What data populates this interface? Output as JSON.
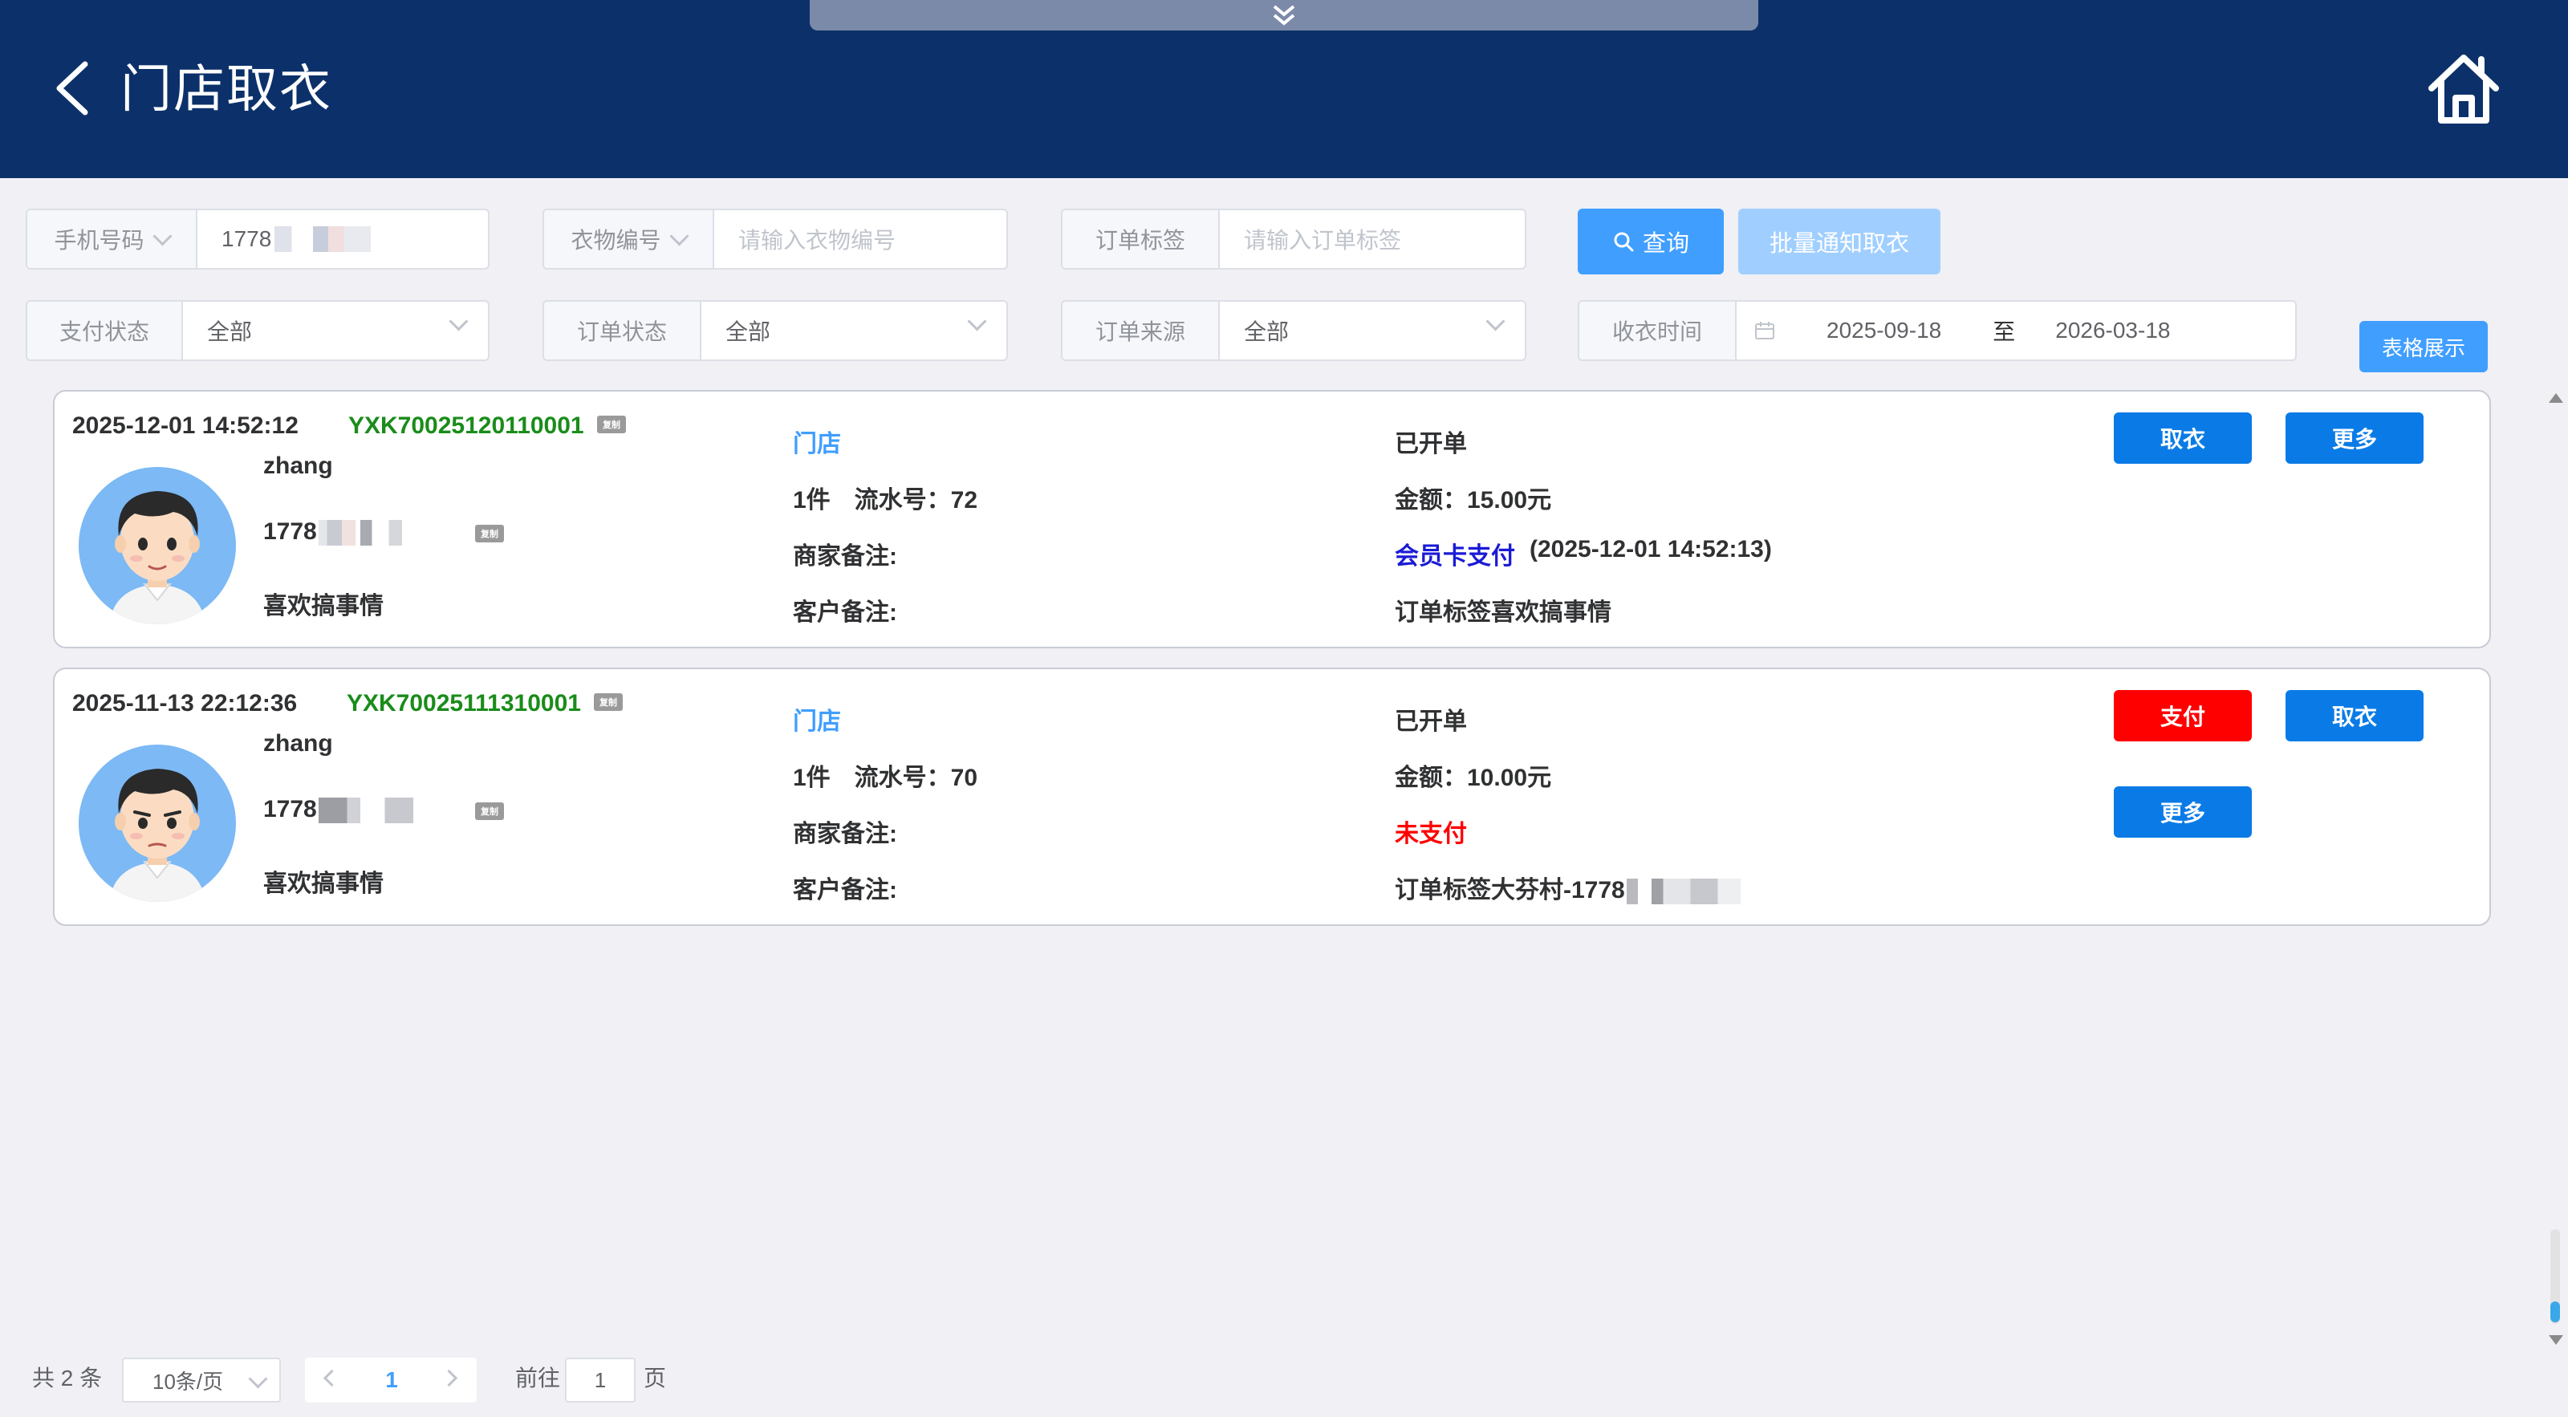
{
  "header": {
    "title": "门店取衣"
  },
  "filters": {
    "phone": {
      "label": "手机号码",
      "value": "1778"
    },
    "cloth": {
      "label": "衣物编号",
      "placeholder": "请输入衣物编号"
    },
    "tag": {
      "label": "订单标签",
      "placeholder": "请输入订单标签"
    },
    "query_label": "查询",
    "batch_label": "批量通知取衣",
    "pay_status": {
      "label": "支付状态",
      "value": "全部"
    },
    "order_status": {
      "label": "订单状态",
      "value": "全部"
    },
    "order_source": {
      "label": "订单来源",
      "value": "全部"
    },
    "time": {
      "label": "收衣时间",
      "start": "2025-09-18",
      "separator": "至",
      "end": "2026-03-18"
    },
    "table_view_label": "表格展示"
  },
  "orders": [
    {
      "datetime": "2025-12-01 14:52:12",
      "order_no": "YXK70025120110001",
      "copy": "复制",
      "name": "zhang",
      "phone": "1778",
      "note": "喜欢搞事情",
      "source": "门店",
      "count_serial": "1件　流水号：72",
      "merchant_note": "商家备注:",
      "customer_note": "客户备注:",
      "status": "已开单",
      "amount": "金额：15.00元",
      "pay_method": "会员卡支付",
      "pay_time": "(2025-12-01 14:52:13)",
      "tag": "订单标签喜欢搞事情",
      "btn_pickup": "取衣",
      "btn_more": "更多"
    },
    {
      "datetime": "2025-11-13 22:12:36",
      "order_no": "YXK70025111310001",
      "copy": "复制",
      "name": "zhang",
      "phone": "1778",
      "note": "喜欢搞事情",
      "source": "门店",
      "count_serial": "1件　流水号：70",
      "merchant_note": "商家备注:",
      "customer_note": "客户备注:",
      "status": "已开单",
      "amount": "金额：10.00元",
      "pay_status": "未支付",
      "tag": "订单标签大芬村-1778",
      "btn_pay": "支付",
      "btn_pickup": "取衣",
      "btn_more": "更多"
    }
  ],
  "pagination": {
    "total": "共 2 条",
    "page_size": "10条/页",
    "current": "1",
    "goto_label": "前往",
    "goto_value": "1",
    "goto_unit": "页"
  },
  "colors": {
    "header_bg": "#0c316a",
    "primary": "#409eff",
    "order_no": "#1a8c1a",
    "danger": "#ff0000",
    "paid_method": "#1a1ad6"
  },
  "icons": [
    "chevrons-down-icon",
    "back-arrow-icon",
    "home-icon",
    "search-icon",
    "calendar-icon",
    "avatar-icon"
  ]
}
